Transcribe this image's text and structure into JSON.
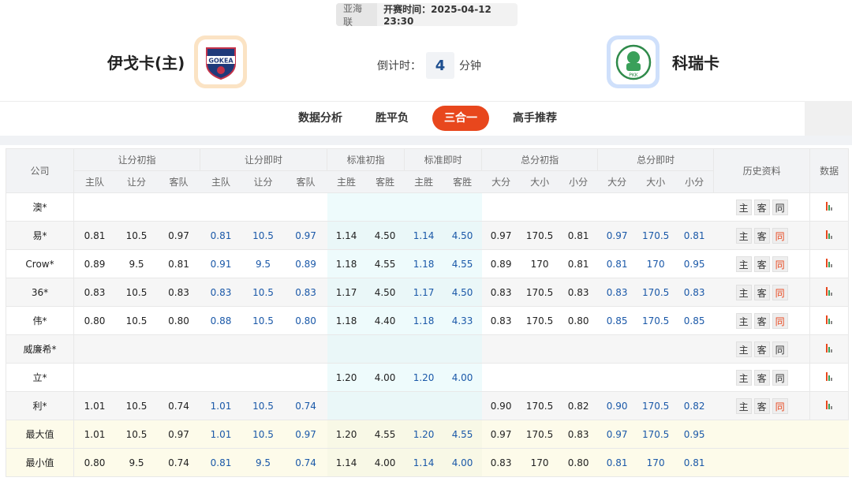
{
  "match": {
    "league": "亚海联",
    "kickoff": "开赛时间：2025-04-12 23:30",
    "home_team": "伊戈卡(主)",
    "away_team": "科瑞卡",
    "home_logo_text": "GOKEA",
    "away_logo_text": "PKK",
    "countdown_label": "倒计时：",
    "countdown_value": "4",
    "countdown_unit": "分钟"
  },
  "tabs": [
    "数据分析",
    "胜平负",
    "三合一",
    "高手推荐"
  ],
  "active_tab": "三合一",
  "colors": {
    "accent": "#e8471d",
    "current_odds": "#1a58a8",
    "std_bg": "#eefbfc",
    "summary_bg": "#fdfbea"
  },
  "table": {
    "group_headers": {
      "company": "公司",
      "hcap_init": "让分初指",
      "hcap_live": "让分即时",
      "std_init": "标准初指",
      "std_live": "标准即时",
      "total_init": "总分初指",
      "total_live": "总分即时",
      "history": "历史资料",
      "data": "数据"
    },
    "sub_headers": {
      "hcap_init": [
        "主队",
        "让分",
        "客队"
      ],
      "hcap_live": [
        "主队",
        "让分",
        "客队"
      ],
      "std_init": [
        "主胜",
        "客胜"
      ],
      "std_live": [
        "主胜",
        "客胜"
      ],
      "total_init": [
        "大分",
        "大小",
        "小分"
      ],
      "total_live": [
        "大分",
        "大小",
        "小分"
      ]
    },
    "history_buttons": [
      "主",
      "客",
      "同"
    ],
    "rows": [
      {
        "company": "澳*",
        "hi": [
          "",
          "",
          ""
        ],
        "hl": [
          "",
          "",
          ""
        ],
        "si": [
          "",
          ""
        ],
        "sl": [
          "",
          ""
        ],
        "ti": [
          "",
          "",
          ""
        ],
        "tl": [
          "",
          "",
          ""
        ],
        "same_hot": false
      },
      {
        "company": "易*",
        "hi": [
          "0.81",
          "10.5",
          "0.97"
        ],
        "hl": [
          "0.81",
          "10.5",
          "0.97"
        ],
        "si": [
          "1.14",
          "4.50"
        ],
        "sl": [
          "1.14",
          "4.50"
        ],
        "ti": [
          "0.97",
          "170.5",
          "0.81"
        ],
        "tl": [
          "0.97",
          "170.5",
          "0.81"
        ],
        "same_hot": true
      },
      {
        "company": "Crow*",
        "hi": [
          "0.89",
          "9.5",
          "0.81"
        ],
        "hl": [
          "0.91",
          "9.5",
          "0.89"
        ],
        "si": [
          "1.18",
          "4.55"
        ],
        "sl": [
          "1.18",
          "4.55"
        ],
        "ti": [
          "0.89",
          "170",
          "0.81"
        ],
        "tl": [
          "0.81",
          "170",
          "0.95"
        ],
        "same_hot": true
      },
      {
        "company": "36*",
        "hi": [
          "0.83",
          "10.5",
          "0.83"
        ],
        "hl": [
          "0.83",
          "10.5",
          "0.83"
        ],
        "si": [
          "1.17",
          "4.50"
        ],
        "sl": [
          "1.17",
          "4.50"
        ],
        "ti": [
          "0.83",
          "170.5",
          "0.83"
        ],
        "tl": [
          "0.83",
          "170.5",
          "0.83"
        ],
        "same_hot": true
      },
      {
        "company": "伟*",
        "hi": [
          "0.80",
          "10.5",
          "0.80"
        ],
        "hl": [
          "0.88",
          "10.5",
          "0.80"
        ],
        "si": [
          "1.18",
          "4.40"
        ],
        "sl": [
          "1.18",
          "4.33"
        ],
        "ti": [
          "0.83",
          "170.5",
          "0.80"
        ],
        "tl": [
          "0.85",
          "170.5",
          "0.85"
        ],
        "same_hot": true
      },
      {
        "company": "威廉希*",
        "hi": [
          "",
          "",
          ""
        ],
        "hl": [
          "",
          "",
          ""
        ],
        "si": [
          "",
          ""
        ],
        "sl": [
          "",
          ""
        ],
        "ti": [
          "",
          "",
          ""
        ],
        "tl": [
          "",
          "",
          ""
        ],
        "same_hot": false
      },
      {
        "company": "立*",
        "hi": [
          "",
          "",
          ""
        ],
        "hl": [
          "",
          "",
          ""
        ],
        "si": [
          "1.20",
          "4.00"
        ],
        "sl": [
          "1.20",
          "4.00"
        ],
        "ti": [
          "",
          "",
          ""
        ],
        "tl": [
          "",
          "",
          ""
        ],
        "same_hot": false
      },
      {
        "company": "利*",
        "hi": [
          "1.01",
          "10.5",
          "0.74"
        ],
        "hl": [
          "1.01",
          "10.5",
          "0.74"
        ],
        "si": [
          "",
          ""
        ],
        "sl": [
          "",
          ""
        ],
        "ti": [
          "0.90",
          "170.5",
          "0.82"
        ],
        "tl": [
          "0.90",
          "170.5",
          "0.82"
        ],
        "same_hot": true
      }
    ],
    "summary": [
      {
        "label": "最大值",
        "hi": [
          "1.01",
          "10.5",
          "0.97"
        ],
        "hl": [
          "1.01",
          "10.5",
          "0.97"
        ],
        "si": [
          "1.20",
          "4.55"
        ],
        "sl": [
          "1.20",
          "4.55"
        ],
        "ti": [
          "0.97",
          "170.5",
          "0.83"
        ],
        "tl": [
          "0.97",
          "170.5",
          "0.95"
        ]
      },
      {
        "label": "最小值",
        "hi": [
          "0.80",
          "9.5",
          "0.74"
        ],
        "hl": [
          "0.81",
          "9.5",
          "0.74"
        ],
        "si": [
          "1.14",
          "4.00"
        ],
        "sl": [
          "1.14",
          "4.00"
        ],
        "ti": [
          "0.83",
          "170",
          "0.80"
        ],
        "tl": [
          "0.81",
          "170",
          "0.81"
        ]
      }
    ]
  }
}
